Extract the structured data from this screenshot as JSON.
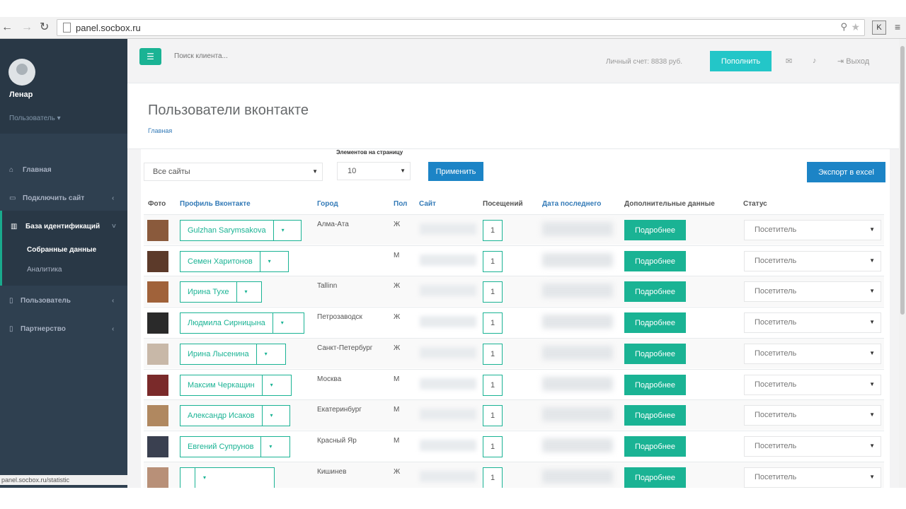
{
  "browser": {
    "url": "panel.socbox.ru",
    "status_url": "panel.socbox.ru/statistic"
  },
  "sidebar": {
    "user_name": "Ленар",
    "user_role": "Пользователь ▾",
    "items": [
      {
        "label": "Главная",
        "icon": "home-icon"
      },
      {
        "label": "Подключить сайт",
        "icon": "monitor-icon"
      },
      {
        "label": "База идентификаций",
        "icon": "bar-chart-icon"
      },
      {
        "label": "Пользователь",
        "icon": "bookmark-icon"
      },
      {
        "label": "Партнерство",
        "icon": "bookmark-icon"
      }
    ],
    "sub_items": [
      "Собранные данные",
      "Аналитика"
    ]
  },
  "header": {
    "search_placeholder": "Поиск клиента...",
    "balance": "Личный счет: 8838 руб.",
    "topup_label": "Пополнить",
    "logout_label": "Выход"
  },
  "page": {
    "title": "Пользователи вконтакте",
    "breadcrumb": "Главная"
  },
  "filters": {
    "site_select": "Все сайты",
    "per_page_label": "Элементов на страницу",
    "per_page_value": "10",
    "apply_label": "Применить",
    "export_label": "Экспорт в excel"
  },
  "table": {
    "headers": [
      "Фото",
      "Профиль Вконтакте",
      "Город",
      "Пол",
      "Сайт",
      "Посещений",
      "Дата последнего",
      "Дополнительные данные",
      "Статус"
    ],
    "more_label": "Подробнее",
    "status_value": "Посетитель",
    "rows": [
      {
        "name": "Gulzhan Sarymsakova",
        "city": "Алма-Ата",
        "sex": "Ж",
        "visits": "1",
        "photo_color": "#8a5a3c"
      },
      {
        "name": "Семен Харитонов",
        "city": "",
        "sex": "М",
        "visits": "1",
        "photo_color": "#5c3a2a"
      },
      {
        "name": "Ирина Тухе",
        "city": "Tallinn",
        "sex": "Ж",
        "visits": "1",
        "photo_color": "#a0623a"
      },
      {
        "name": "Людмила Сирницына",
        "city": "Петрозаводск",
        "sex": "Ж",
        "visits": "1",
        "photo_color": "#2a2a2a"
      },
      {
        "name": "Ирина Лысенина",
        "city": "Санкт-Петербург",
        "sex": "Ж",
        "visits": "1",
        "photo_color": "#c8b8a8"
      },
      {
        "name": "Максим Черкащин",
        "city": "Москва",
        "sex": "М",
        "visits": "1",
        "photo_color": "#7a2a2a"
      },
      {
        "name": "Александр Исаков",
        "city": "Екатеринбург",
        "sex": "М",
        "visits": "1",
        "photo_color": "#b08860"
      },
      {
        "name": "Евгений Супрунов",
        "city": "Красный Яр",
        "sex": "М",
        "visits": "1",
        "photo_color": "#3a4050"
      },
      {
        "name": "",
        "city": "Кишинев",
        "sex": "Ж",
        "visits": "1",
        "photo_color": "#b89078"
      }
    ]
  },
  "colors": {
    "primary": "#1ab394",
    "info": "#23c6c8",
    "success": "#1c84c6",
    "sidebar": "#2f4050"
  }
}
